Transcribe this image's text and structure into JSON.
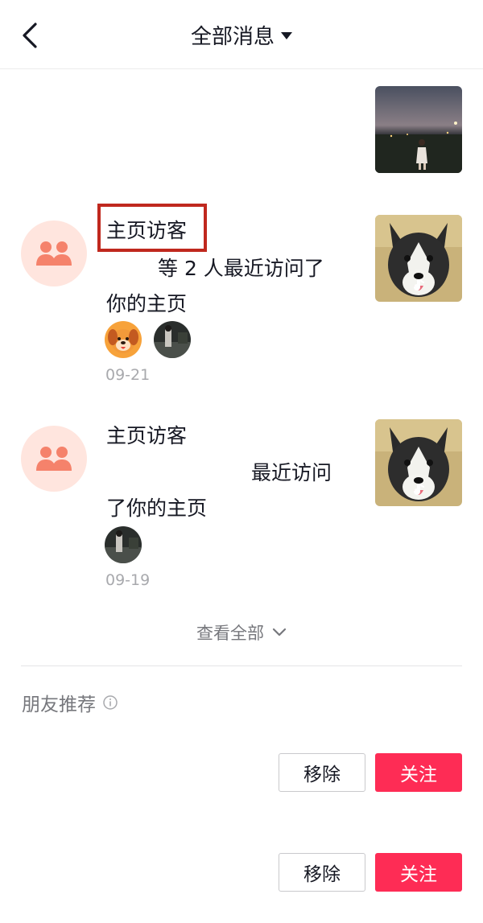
{
  "header": {
    "title": "全部消息",
    "back_icon": "chevron-left-icon",
    "dropdown_icon": "triangle-down-icon"
  },
  "notifications": [
    {
      "title": "主页访客",
      "line1": "等 2 人最近访问了",
      "line2": "你的主页",
      "date": "09-21",
      "visitor_avatars": [
        "dog-cartoon-avatar",
        "night-road-avatar"
      ]
    },
    {
      "title": "主页访客",
      "line1": "最近访问",
      "line2": "了你的主页",
      "date": "09-19",
      "visitor_avatars": [
        "night-road-avatar"
      ]
    }
  ],
  "view_all": {
    "label": "查看全部",
    "icon": "chevron-down-icon"
  },
  "friends_section": {
    "title": "朋友推荐",
    "info_icon": "info-icon",
    "items": [
      {
        "remove_label": "移除",
        "follow_label": "关注"
      },
      {
        "remove_label": "移除",
        "follow_label": "关注"
      }
    ]
  },
  "colors": {
    "follow": "#fe2c55",
    "highlight": "#c0281e",
    "avatar_bg": "#ffe5de",
    "avatar_icon": "#f5826b"
  }
}
